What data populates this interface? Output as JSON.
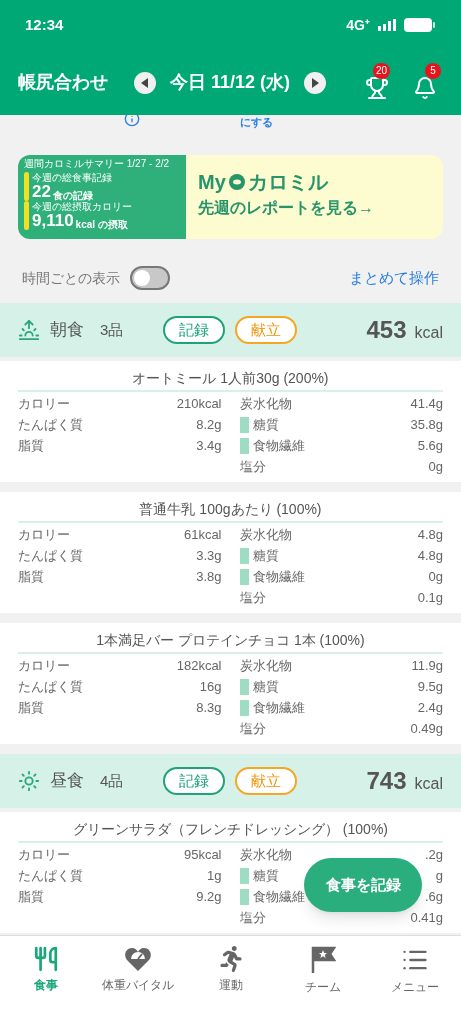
{
  "status_bar": {
    "time": "12:34",
    "network": "4G⁺"
  },
  "header": {
    "title": "帳尻合わせ",
    "date": "今日 11/12 (水)",
    "trophy_badge": "20",
    "bell_badge": "5"
  },
  "notice": {
    "link": "にする"
  },
  "banner": {
    "summary_title": "週間カロミルサマリー 1/27 - 2/2",
    "meals_label": "今週の総食事記録",
    "meals_value": "22",
    "meals_unit": "食の記録",
    "kcal_label": "今週の総摂取カロリー",
    "kcal_value": "9,110",
    "kcal_unit": "kcal の摂取",
    "brand_prefix": "My",
    "brand": "カロミル",
    "cta": "先週のレポートを見る→"
  },
  "controls": {
    "hourly_label": "時間ごとの表示",
    "hourly_on": false,
    "bulk_action": "まとめて操作"
  },
  "meals": [
    {
      "kind": "morning",
      "name": "朝食",
      "count": "3品",
      "record": "記録",
      "menu": "献立",
      "kcal": "453",
      "unit": "kcal",
      "foods": [
        {
          "title": "オートミール 1人前30g (200%)",
          "left": [
            {
              "label": "カロリー",
              "value": "210kcal"
            },
            {
              "label": "たんぱく質",
              "value": "8.2g"
            },
            {
              "label": "脂質",
              "value": "3.4g"
            }
          ],
          "right": [
            {
              "label": "炭水化物",
              "value": "41.4g",
              "sub": false
            },
            {
              "label": "糖質",
              "value": "35.8g",
              "sub": true
            },
            {
              "label": "食物繊維",
              "value": "5.6g",
              "sub": true
            },
            {
              "label": "塩分",
              "value": "0g",
              "sub": false
            }
          ]
        },
        {
          "title": "普通牛乳 100gあたり (100%)",
          "left": [
            {
              "label": "カロリー",
              "value": "61kcal"
            },
            {
              "label": "たんぱく質",
              "value": "3.3g"
            },
            {
              "label": "脂質",
              "value": "3.8g"
            }
          ],
          "right": [
            {
              "label": "炭水化物",
              "value": "4.8g",
              "sub": false
            },
            {
              "label": "糖質",
              "value": "4.8g",
              "sub": true
            },
            {
              "label": "食物繊維",
              "value": "0g",
              "sub": true
            },
            {
              "label": "塩分",
              "value": "0.1g",
              "sub": false
            }
          ]
        },
        {
          "title": "1本満足バー プロテインチョコ 1本 (100%)",
          "left": [
            {
              "label": "カロリー",
              "value": "182kcal"
            },
            {
              "label": "たんぱく質",
              "value": "16g"
            },
            {
              "label": "脂質",
              "value": "8.3g"
            }
          ],
          "right": [
            {
              "label": "炭水化物",
              "value": "11.9g",
              "sub": false
            },
            {
              "label": "糖質",
              "value": "9.5g",
              "sub": true
            },
            {
              "label": "食物繊維",
              "value": "2.4g",
              "sub": true
            },
            {
              "label": "塩分",
              "value": "0.49g",
              "sub": false
            }
          ]
        }
      ]
    },
    {
      "kind": "noon",
      "name": "昼食",
      "count": "4品",
      "record": "記録",
      "menu": "献立",
      "kcal": "743",
      "unit": "kcal",
      "foods": [
        {
          "title": "グリーンサラダ（フレンチドレッシング） (100%)",
          "left": [
            {
              "label": "カロリー",
              "value": "95kcal"
            },
            {
              "label": "たんぱく質",
              "value": "1g"
            },
            {
              "label": "脂質",
              "value": "9.2g"
            }
          ],
          "right": [
            {
              "label": "炭水化物",
              "value": ".2g",
              "sub": false
            },
            {
              "label": "糖質",
              "value": "g",
              "sub": true
            },
            {
              "label": "食物繊維",
              "value": ".6g",
              "sub": true
            },
            {
              "label": "塩分",
              "value": "0.41g",
              "sub": false
            }
          ]
        }
      ]
    }
  ],
  "fab": "食事を記録",
  "tabs": [
    {
      "kind": "meal",
      "label": "食事",
      "selected": true
    },
    {
      "kind": "vital",
      "label": "体重バイタル",
      "selected": false
    },
    {
      "kind": "exercise",
      "label": "運動",
      "selected": false
    },
    {
      "kind": "team",
      "label": "チーム",
      "selected": false
    },
    {
      "kind": "menu",
      "label": "メニュー",
      "selected": false
    }
  ]
}
